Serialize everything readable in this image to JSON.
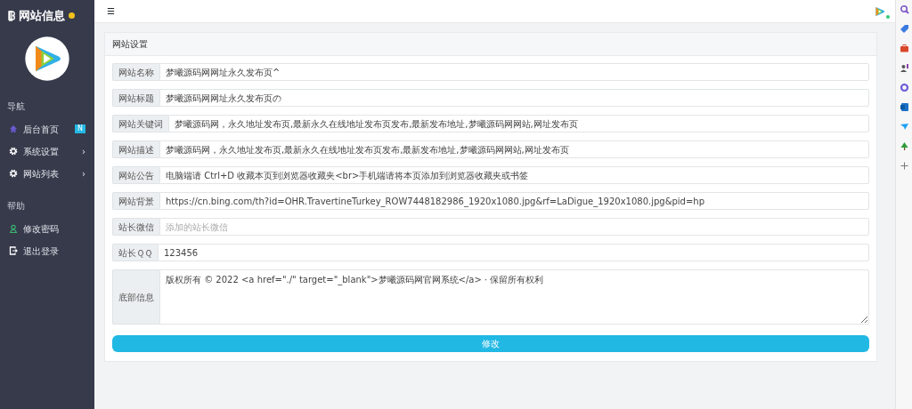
{
  "sidebar": {
    "brand": "网站信息",
    "sections": [
      {
        "title": "导航",
        "items": [
          {
            "label": "后台首页",
            "badge": "N"
          },
          {
            "label": "系统设置",
            "chevron": "›"
          },
          {
            "label": "网站列表",
            "chevron": "›"
          }
        ]
      },
      {
        "title": "帮助",
        "items": [
          {
            "label": "修改密码"
          },
          {
            "label": "退出登录"
          }
        ]
      }
    ]
  },
  "topbar": {
    "menu_icon": "☰"
  },
  "card": {
    "title": "网站设置",
    "fields": [
      {
        "label": "网站名称",
        "kind": "input",
        "value": "梦曦源码网网址永久发布页^"
      },
      {
        "label": "网站标题",
        "kind": "input",
        "value": "梦曦源码网网址永久发布页の"
      },
      {
        "label": "网站关键词",
        "kind": "input",
        "value": "梦曦源码网，永久地址发布页,最新永久在线地址发布页发布,最新发布地址,梦曦源码网网站,网址发布页"
      },
      {
        "label": "网站描述",
        "kind": "input",
        "value": "梦曦源码网，永久地址发布页,最新永久在线地址发布页发布,最新发布地址,梦曦源码网网站,网址发布页"
      },
      {
        "label": "网站公告",
        "kind": "input",
        "value": "电脑端请 Ctrl+D 收藏本页到浏览器收藏夹<br>手机端请将本页添加到浏览器收藏夹或书签"
      },
      {
        "label": "网站背景",
        "kind": "input",
        "value": "https://cn.bing.com/th?id=OHR.TravertineTurkey_ROW7448182986_1920x1080.jpg&rf=LaDigue_1920x1080.jpg&pid=hp"
      },
      {
        "label": "站长微信",
        "kind": "input",
        "placeholder": "添加的站长微信"
      },
      {
        "label": "站长ＱＱ",
        "kind": "input",
        "value": "123456"
      },
      {
        "label": "底部信息",
        "kind": "textarea",
        "value": "版权所有 © 2022 <a href=\"./\" target=\"_blank\">梦曦源码网官网系统</a> · 保留所有权利"
      }
    ],
    "submit": "修改"
  }
}
